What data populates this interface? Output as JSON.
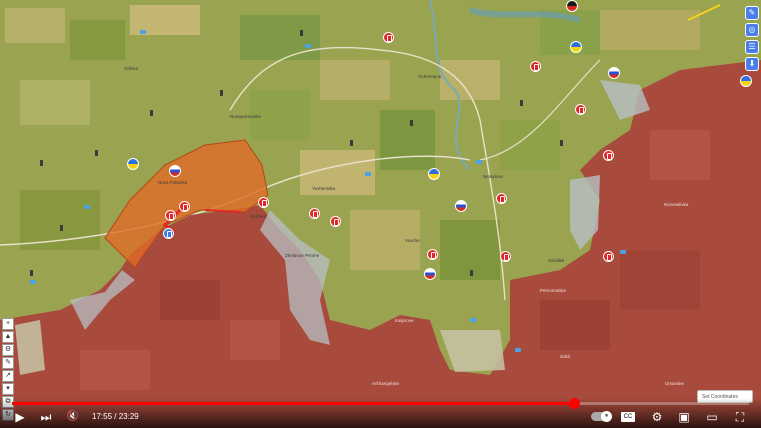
{
  "video": {
    "current_time": "17:55",
    "duration": "23:29",
    "progress": 0.763
  },
  "map": {
    "labels": [
      "Nova Poltavka",
      "Prohres",
      "Yevhenivka",
      "Novopokrovske",
      "Zhelanne Pershe",
      "Kalynove",
      "Vovche",
      "Ocheretyne",
      "Netaylove",
      "Solodke",
      "Arkhangelske",
      "Pervomaiske",
      "Sokil",
      "Umanske",
      "Novoselivka",
      "Orlivka"
    ],
    "unit_flags": [
      "ua",
      "ru",
      "ua",
      "ua",
      "ru",
      "ua",
      "ru",
      "bk",
      "ru"
    ]
  },
  "map_tools": {
    "right": [
      "✎",
      "◎",
      "☰",
      "⬇"
    ],
    "left": [
      "+",
      "▲",
      "⚙",
      "✎",
      "↗",
      "▾",
      "⧉",
      "↻"
    ]
  },
  "coordinates_box": "Set Coordinates",
  "controls": {
    "play_icon": "▶",
    "next_icon": "⏭",
    "mute_icon": "🔇",
    "autoplay_icon": "⏸",
    "settings_icon": "⚙",
    "miniplayer_icon": "▣",
    "theater_icon": "▭",
    "fullscreen_icon": "⛶"
  },
  "colors": {
    "occupied": "#a84a3c",
    "contested": "#e06a28",
    "terrain_light": "#a6ae5c",
    "terrain_dark": "#76903e",
    "progress": "#ff0000"
  }
}
